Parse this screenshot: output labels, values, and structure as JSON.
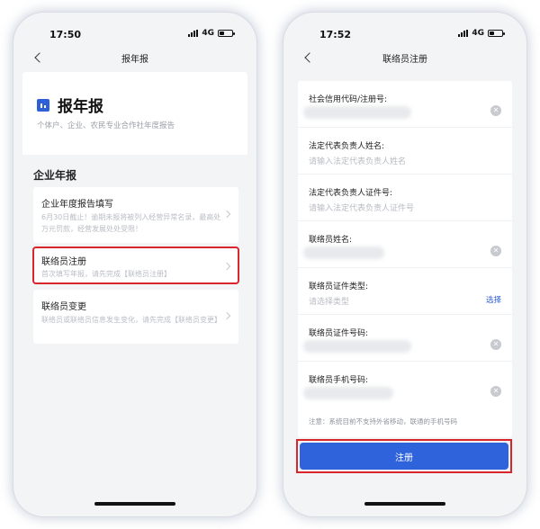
{
  "left": {
    "status": {
      "time": "17:50",
      "network": "4G"
    },
    "nav_title": "报年报",
    "hero_title": "报年报",
    "hero_subtitle": "个体户、企业、农民专业合作社年度报告",
    "section_title": "企业年报",
    "cards": [
      {
        "title": "企业年度报告填写",
        "desc": "6月30日截止！逾期未报将被列入经营异常名录，最高处万元罚款，经营发展处处受限！"
      },
      {
        "title": "联络员注册",
        "desc": "首次填写年报，请先完成【联络员注册】"
      },
      {
        "title": "联络员变更",
        "desc": "联络员或联络员信息发生变化，请先完成【联络员变更】"
      }
    ]
  },
  "right": {
    "status": {
      "time": "17:52",
      "network": "4G"
    },
    "nav_title": "联络员注册",
    "fields": [
      {
        "label": "社会信用代码/注册号:"
      },
      {
        "label": "法定代表负责人姓名:",
        "placeholder": "请输入法定代表负责人姓名"
      },
      {
        "label": "法定代表负责人证件号:",
        "placeholder": "请输入法定代表负责人证件号"
      },
      {
        "label": "联络员姓名:"
      },
      {
        "label": "联络员证件类型:",
        "placeholder": "请选择类型",
        "action": "选择"
      },
      {
        "label": "联络员证件号码:"
      },
      {
        "label": "联络员手机号码:"
      }
    ],
    "note": "注意：系统目前不支持外省移动，联通的手机号码",
    "submit_label": "注册"
  },
  "icons": {
    "back": "chevron-left-icon",
    "clear": "clear-circle-icon",
    "chevron": "chevron-right-icon"
  },
  "colors": {
    "primary": "#2f63dc",
    "highlight": "#d9262c"
  }
}
